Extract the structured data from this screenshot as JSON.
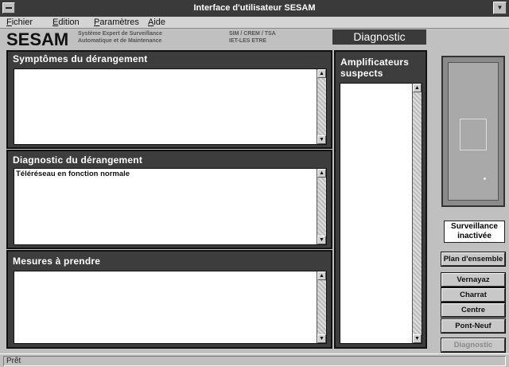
{
  "window": {
    "title": "Interface d'utilisateur SESAM",
    "sysmenu_icon": "system-menu-icon",
    "maximize_icon": "maximize-icon"
  },
  "menubar": {
    "items": [
      "Fichier",
      "Edition",
      "Paramètres",
      "Aide"
    ]
  },
  "header": {
    "logo": "SESAM",
    "subtitle_line1": "Système Expert de Surveillance",
    "subtitle_line2": "Automatique et de Maintenance",
    "org_line1": "SIM / CREM / TSA",
    "org_line2": "IET-LES ETRE",
    "section_title": "Diagnostic"
  },
  "panels": {
    "symptoms": {
      "title": "Symptômes du dérangement",
      "content": ""
    },
    "diagnosis": {
      "title": "Diagnostic du dérangement",
      "content": "Téléréseau en fonction normale"
    },
    "measures": {
      "title": "Mesures à prendre",
      "content": ""
    },
    "amplifiers": {
      "title_line1": "Amplificateurs",
      "title_line2": "suspects",
      "content": ""
    }
  },
  "sidebar": {
    "status_line1": "Surveillance",
    "status_line2": "inactivée",
    "buttons": [
      "Plan d'ensemble",
      "Vernayaz",
      "Charrat",
      "Centre",
      "Pont-Neuf",
      "Diagnostic"
    ]
  },
  "statusbar": {
    "text": "Prêt"
  },
  "scroll_icons": {
    "up": "▲",
    "down": "▼"
  },
  "colors": {
    "title_bar": "#3a3a3a",
    "panel_bg": "#3d3d3d",
    "window_bg": "#c0c0c0"
  }
}
